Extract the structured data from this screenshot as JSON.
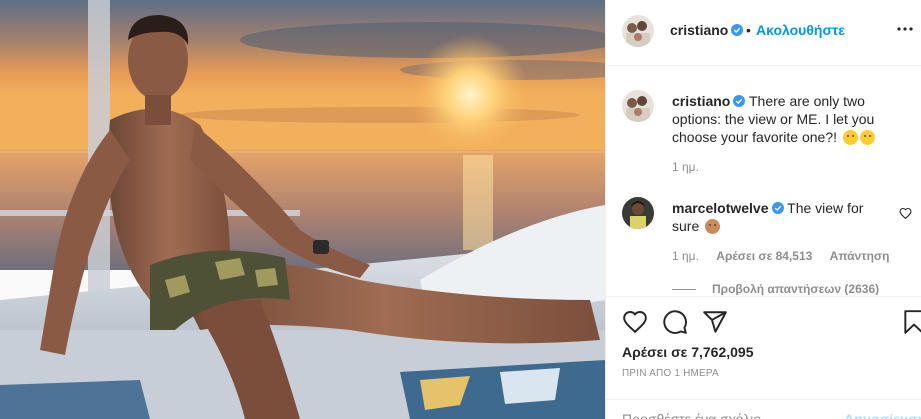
{
  "header": {
    "username": "cristiano",
    "separator": "•",
    "follow_label": "Ακολουθήστε",
    "more_icon": "more-horizontal-icon"
  },
  "caption": {
    "username": "cristiano",
    "text": "There are only two options: the view or ME. I let you choose your favorite one?!",
    "emojis": [
      "thinking-face-emoji",
      "grinning-sweat-emoji"
    ],
    "time": "1 ημ."
  },
  "comment": {
    "username": "marcelotwelve",
    "text": "The view for sure",
    "emoji": "man-in-lotus-position-emoji",
    "time": "1 ημ.",
    "likes": "Αρέσει σε 84,513",
    "reply_label": "Απάντηση",
    "view_replies": "Προβολή απαντήσεων (2636)"
  },
  "actions": {
    "icons": [
      "heart-icon",
      "comment-icon",
      "share-icon",
      "bookmark-icon"
    ],
    "likes": "Αρέσει σε 7,762,095",
    "timestamp": "ΠΡΙΝ ΑΠΟ 1 ΗΜΕΡΑ"
  },
  "add_comment": {
    "placeholder": "Προσθέστε ένα σχόλιο...",
    "post_label": "Δημοσίευση"
  },
  "colors": {
    "link": "#0095f6",
    "verified": "#3897f0",
    "muted": "#8e8e8e"
  }
}
